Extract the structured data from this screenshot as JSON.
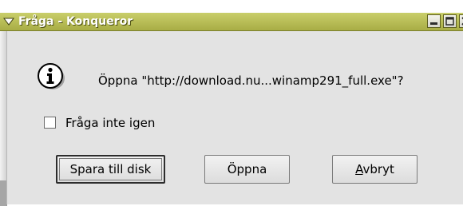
{
  "window": {
    "title": "Fråga - Konqueror",
    "title_color": "#a8ad45"
  },
  "dialog": {
    "icon": "info-icon",
    "question": "Öppna \"http://download.nu...winamp291_full.exe\"?",
    "checkbox": {
      "label": "Fråga inte igen",
      "checked": false
    },
    "buttons": {
      "save": "Spara till disk",
      "open": "Öppna",
      "cancel": "Avbryt"
    }
  }
}
